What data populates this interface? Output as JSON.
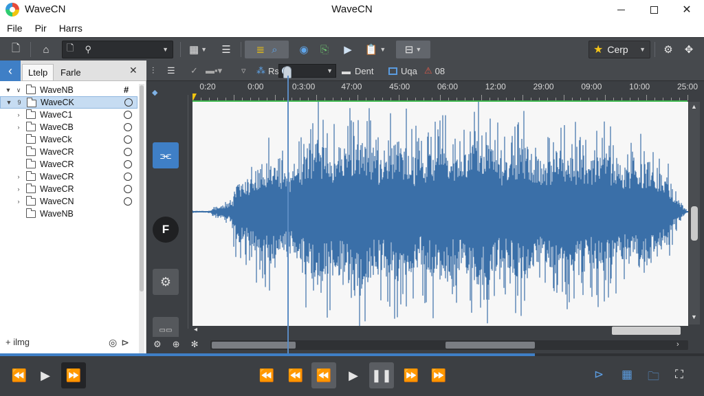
{
  "window": {
    "app_name": "WaveCN",
    "title": "WaveCN"
  },
  "menu": [
    "File",
    "Pir",
    "Harrs"
  ],
  "toolbar": {
    "crop_label": "Cerp",
    "colors": {
      "bg": "#474a4e",
      "accent": "#3f7fc6",
      "star": "#f5c518"
    },
    "icons": [
      "new-file-icon",
      "bookmark-icon",
      "document-icon",
      "pin-icon",
      "grid-icon",
      "list-icon",
      "bars-icon",
      "search-icon",
      "sync-icon",
      "export-icon",
      "play-icon",
      "clipboard-icon",
      "layout-icon",
      "settings-icon",
      "move-icon"
    ]
  },
  "left_panel": {
    "tabs": [
      "Ltelp",
      "Farle"
    ],
    "tree": [
      {
        "label": "WaveNB",
        "status": "#",
        "exp": "▼",
        "exp2": "∨"
      },
      {
        "label": "WaveCK",
        "status": "",
        "exp": "▼",
        "exp2": "9",
        "selected": true
      },
      {
        "label": "WaveC1",
        "status": "",
        "exp": "",
        "exp2": "›"
      },
      {
        "label": "WaveCB",
        "status": "",
        "exp": "",
        "exp2": "›"
      },
      {
        "label": "WaveCk",
        "status": "",
        "exp": "",
        "exp2": ""
      },
      {
        "label": "WaveCR",
        "status": "",
        "exp": "",
        "exp2": ""
      },
      {
        "label": "WaveCR",
        "status": "",
        "exp": "",
        "exp2": ""
      },
      {
        "label": "WaveCR",
        "status": "",
        "exp": "",
        "exp2": "›"
      },
      {
        "label": "WaveCR",
        "status": "",
        "exp": "",
        "exp2": "›"
      },
      {
        "label": "WaveCN",
        "status": "",
        "exp": "",
        "exp2": "›"
      },
      {
        "label": "WaveNB",
        "status": "none",
        "exp": "",
        "exp2": ""
      }
    ],
    "footer_label": "+ ilmg"
  },
  "editor": {
    "toolbar": {
      "rs_label": "Rs",
      "dent_label": "Dent",
      "uqa_label": "Uqa",
      "counter_label": "08"
    },
    "ruler": [
      "0:20",
      "0:00",
      "0:3:00",
      "47:00",
      "45:00",
      "06:00",
      "12:00",
      "29:00",
      "09:00",
      "10:00",
      "25:00"
    ],
    "waveform_color": "#3a6fa8",
    "playhead_fraction": 0.19
  },
  "transport": {
    "progress_fraction": 0.76,
    "buttons_left": [
      "rewind-icon",
      "play-icon",
      "fast-forward-icon"
    ],
    "buttons_center": [
      "skip-back-icon",
      "rewind-icon",
      "rewind-alt-icon",
      "play-icon",
      "pause-icon",
      "fast-forward-icon",
      "skip-forward-icon"
    ],
    "buttons_right": [
      "marker-icon",
      "grid-icon",
      "folder-icon",
      "fullscreen-icon"
    ]
  }
}
